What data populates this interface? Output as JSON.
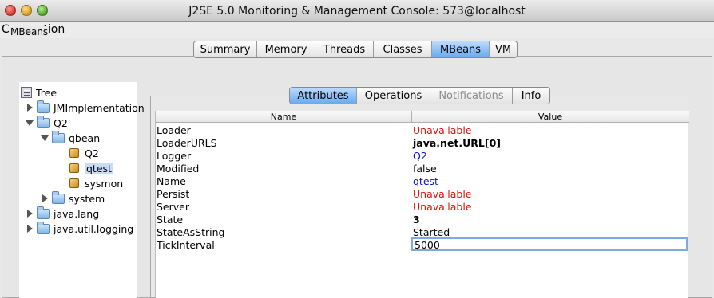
{
  "window": {
    "title": "J2SE 5.0 Monitoring & Management Console: 573@localhost"
  },
  "menubar": {
    "connection": "Connection"
  },
  "main_tabs": [
    {
      "label": "Summary",
      "active": false
    },
    {
      "label": "Memory",
      "active": false
    },
    {
      "label": "Threads",
      "active": false
    },
    {
      "label": "Classes",
      "active": false
    },
    {
      "label": "MBeans",
      "active": true
    },
    {
      "label": "VM",
      "active": false
    }
  ],
  "mbeans_panel": {
    "label": "MBeans"
  },
  "tree": {
    "root": "Tree",
    "nodes": [
      {
        "label": "JMImplementation",
        "icon": "folder-icon",
        "expanded": false
      },
      {
        "label": "Q2",
        "icon": "folder-icon",
        "expanded": true
      },
      {
        "label": "qbean",
        "icon": "folder-icon",
        "expanded": true
      },
      {
        "label": "Q2",
        "icon": "bean-icon"
      },
      {
        "label": "qtest",
        "icon": "bean-icon",
        "selected": true
      },
      {
        "label": "sysmon",
        "icon": "bean-icon"
      },
      {
        "label": "system",
        "icon": "folder-icon",
        "expanded": false
      },
      {
        "label": "java.lang",
        "icon": "folder-icon",
        "expanded": false
      },
      {
        "label": "java.util.logging",
        "icon": "folder-icon",
        "expanded": false
      }
    ]
  },
  "sub_tabs": [
    {
      "label": "Attributes",
      "active": true,
      "enabled": true
    },
    {
      "label": "Operations",
      "active": false,
      "enabled": true
    },
    {
      "label": "Notifications",
      "active": false,
      "enabled": false
    },
    {
      "label": "Info",
      "active": false,
      "enabled": true
    }
  ],
  "attributes_table": {
    "columns": [
      "Name",
      "Value"
    ],
    "rows": [
      {
        "name": "Loader",
        "value": "Unavailable",
        "style": "red"
      },
      {
        "name": "LoaderURLS",
        "value": "java.net.URL[0]",
        "style": "bold"
      },
      {
        "name": "Logger",
        "value": "Q2",
        "style": "blue"
      },
      {
        "name": "Modified",
        "value": "false",
        "style": "plain"
      },
      {
        "name": "Name",
        "value": "qtest",
        "style": "blue"
      },
      {
        "name": "Persist",
        "value": "Unavailable",
        "style": "red"
      },
      {
        "name": "Server",
        "value": "Unavailable",
        "style": "red"
      },
      {
        "name": "State",
        "value": "3",
        "style": "bold"
      },
      {
        "name": "StateAsString",
        "value": "Started",
        "style": "plain"
      },
      {
        "name": "TickInterval",
        "value": "5000",
        "style": "editable"
      }
    ]
  },
  "colors": {
    "active_tab": "#69a9ee",
    "unavailable": "#e0140f",
    "link_value": "#1010c8",
    "selection": "#c8dcf5"
  }
}
